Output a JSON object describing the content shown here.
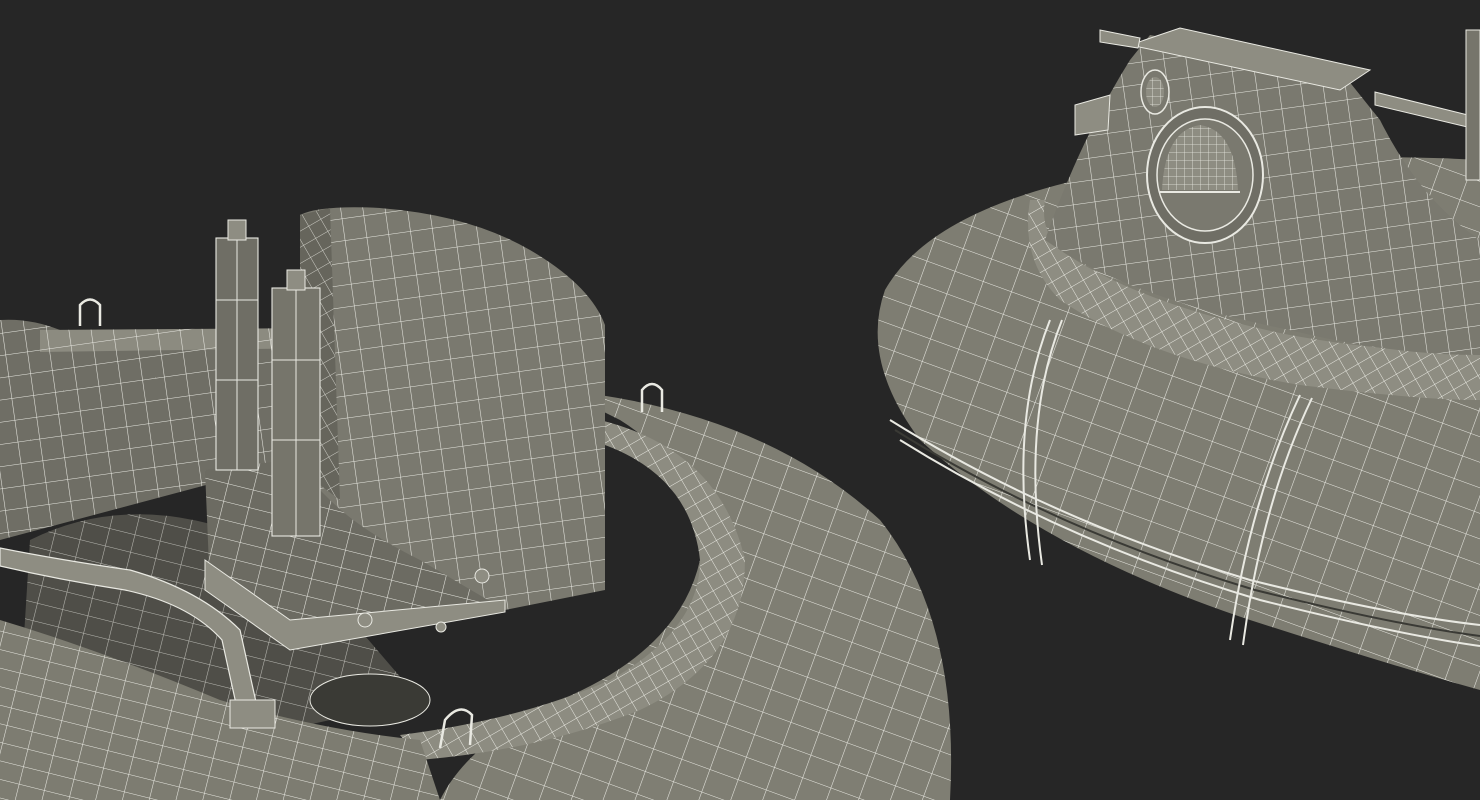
{
  "scene": {
    "colors": {
      "background": "#262626",
      "surface": "#7e7d72",
      "surface_light": "#8a897e",
      "surface_shadow": "#5f5e55",
      "wire": "#e9e9e2",
      "interior": "#4a4a44",
      "dark_gap": "#2b2b28"
    }
  }
}
